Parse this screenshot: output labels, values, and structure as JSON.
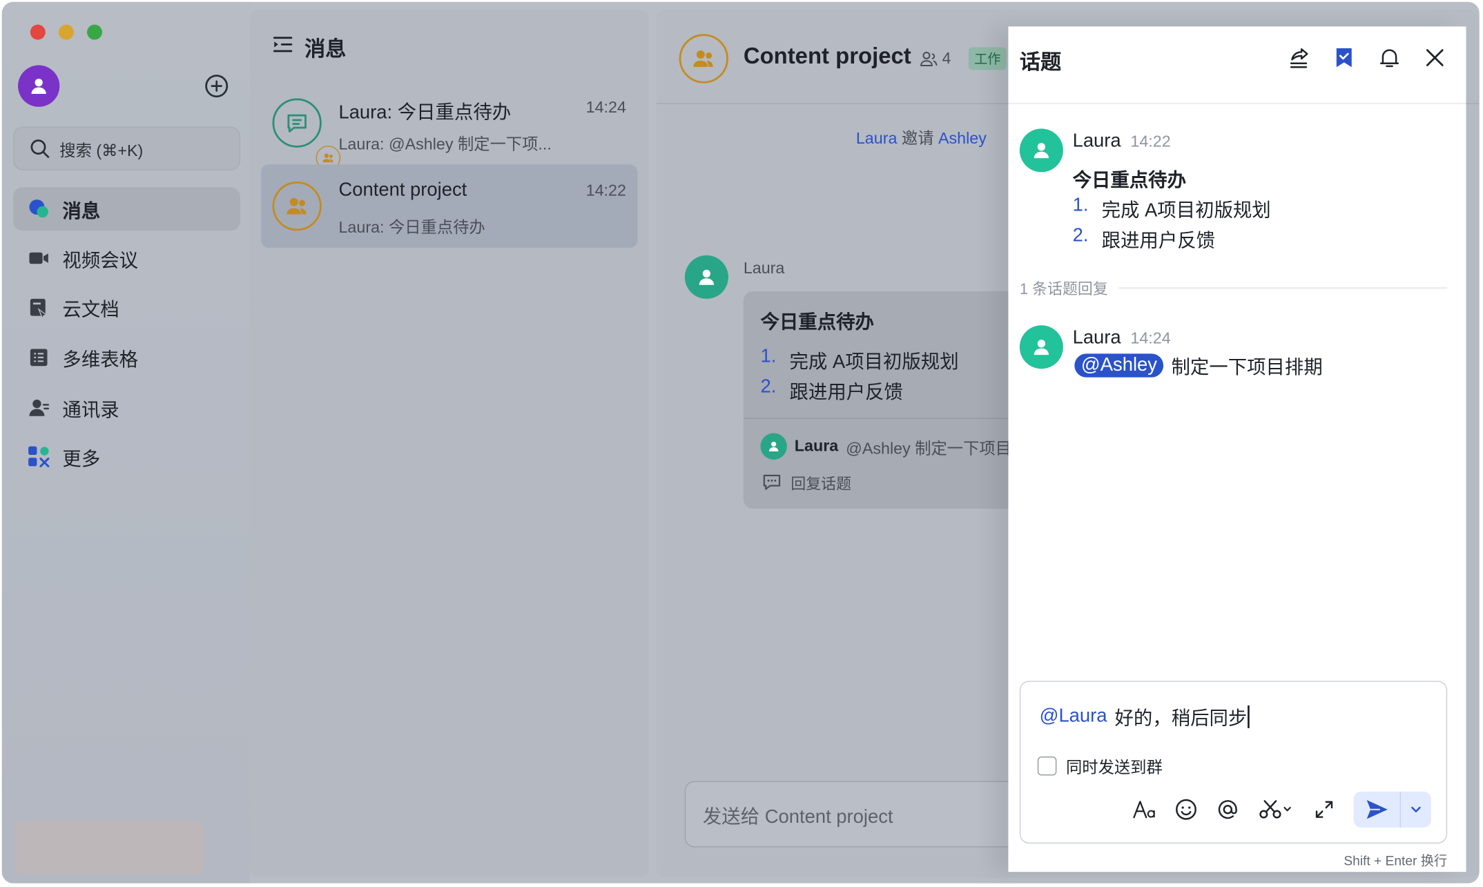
{
  "colors": {
    "accent": "#2a52c9",
    "avatar_me": "#7a32c8",
    "avatar_laura": "#22c29a",
    "group_gold": "#c48b1e"
  },
  "sidebar": {
    "search_placeholder": "搜索 (⌘+K)",
    "items": [
      {
        "label": "消息",
        "icon": "chat-bubbles-icon"
      },
      {
        "label": "视频会议",
        "icon": "video-camera-icon"
      },
      {
        "label": "云文档",
        "icon": "doc-icon"
      },
      {
        "label": "多维表格",
        "icon": "table-icon"
      },
      {
        "label": "通讯录",
        "icon": "contacts-icon"
      },
      {
        "label": "更多",
        "icon": "apps-icon"
      }
    ]
  },
  "chatlist": {
    "title": "消息",
    "conversations": [
      {
        "title": "Laura: 今日重点待办",
        "preview": "Laura: @Ashley 制定一下项...",
        "time": "14:24"
      },
      {
        "title": "Content project",
        "preview": "Laura: 今日重点待办",
        "time": "14:22"
      }
    ]
  },
  "main": {
    "title": "Content project",
    "member_count": "4",
    "tag": "工作",
    "system_message": {
      "actor": "Laura",
      "verb": "邀请",
      "target": "Ashley"
    },
    "message": {
      "sender": "Laura",
      "card_title": "今日重点待办",
      "items": [
        {
          "num": "1.",
          "text": "完成 A项目初版规划"
        },
        {
          "num": "2.",
          "text": "跟进用户反馈"
        }
      ],
      "reply_name": "Laura",
      "reply_text": "@Ashley 制定一下项目排期",
      "reply_topic_label": "回复话题"
    },
    "composer_placeholder": "发送给 Content project"
  },
  "thread": {
    "title": "话题",
    "root": {
      "name": "Laura",
      "time": "14:22",
      "title": "今日重点待办",
      "items": [
        {
          "num": "1.",
          "text": "完成 A项目初版规划"
        },
        {
          "num": "2.",
          "text": "跟进用户反馈"
        }
      ]
    },
    "reply_count_label": "1 条话题回复",
    "reply": {
      "name": "Laura",
      "time": "14:24",
      "mention": "@Ashley",
      "text": "制定一下项目排期"
    },
    "composer": {
      "mention": "@Laura",
      "text": "好的，稍后同步",
      "checkbox_label": "同时发送到群"
    },
    "hint": "Shift + Enter 换行"
  }
}
